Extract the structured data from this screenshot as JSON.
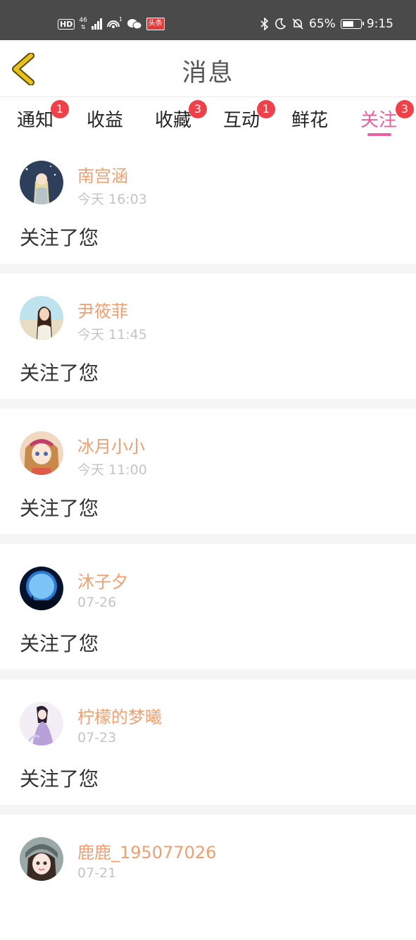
{
  "status_bar": {
    "hd": "HD",
    "net_type": "46",
    "toutiao_label": "头条",
    "battery": "65%",
    "time": "9:15",
    "battery_level": 0.65
  },
  "header": {
    "title": "消息"
  },
  "tabs": [
    {
      "label": "通知",
      "badge": "1"
    },
    {
      "label": "收益",
      "badge": ""
    },
    {
      "label": "收藏",
      "badge": "3"
    },
    {
      "label": "互动",
      "badge": "1"
    },
    {
      "label": "鲜花",
      "badge": ""
    },
    {
      "label": "关注",
      "badge": "3",
      "active": true
    }
  ],
  "items": [
    {
      "name": "南宫涵",
      "time": "今天 16:03",
      "message": "关注了您"
    },
    {
      "name": "尹筱菲",
      "time": "今天 11:45",
      "message": "关注了您"
    },
    {
      "name": "冰月小小",
      "time": "今天 11:00",
      "message": "关注了您"
    },
    {
      "name": "沐子夕",
      "time": "07-26",
      "message": "关注了您"
    },
    {
      "name": "柠檬的梦曦",
      "time": "07-23",
      "message": "关注了您"
    },
    {
      "name": "鹿鹿_195077026",
      "time": "07-21",
      "message": ""
    }
  ],
  "colors": {
    "accent": "#e9609f",
    "badge": "#f0404a",
    "username": "#f0a070",
    "back_icon": "#e8c21c"
  }
}
